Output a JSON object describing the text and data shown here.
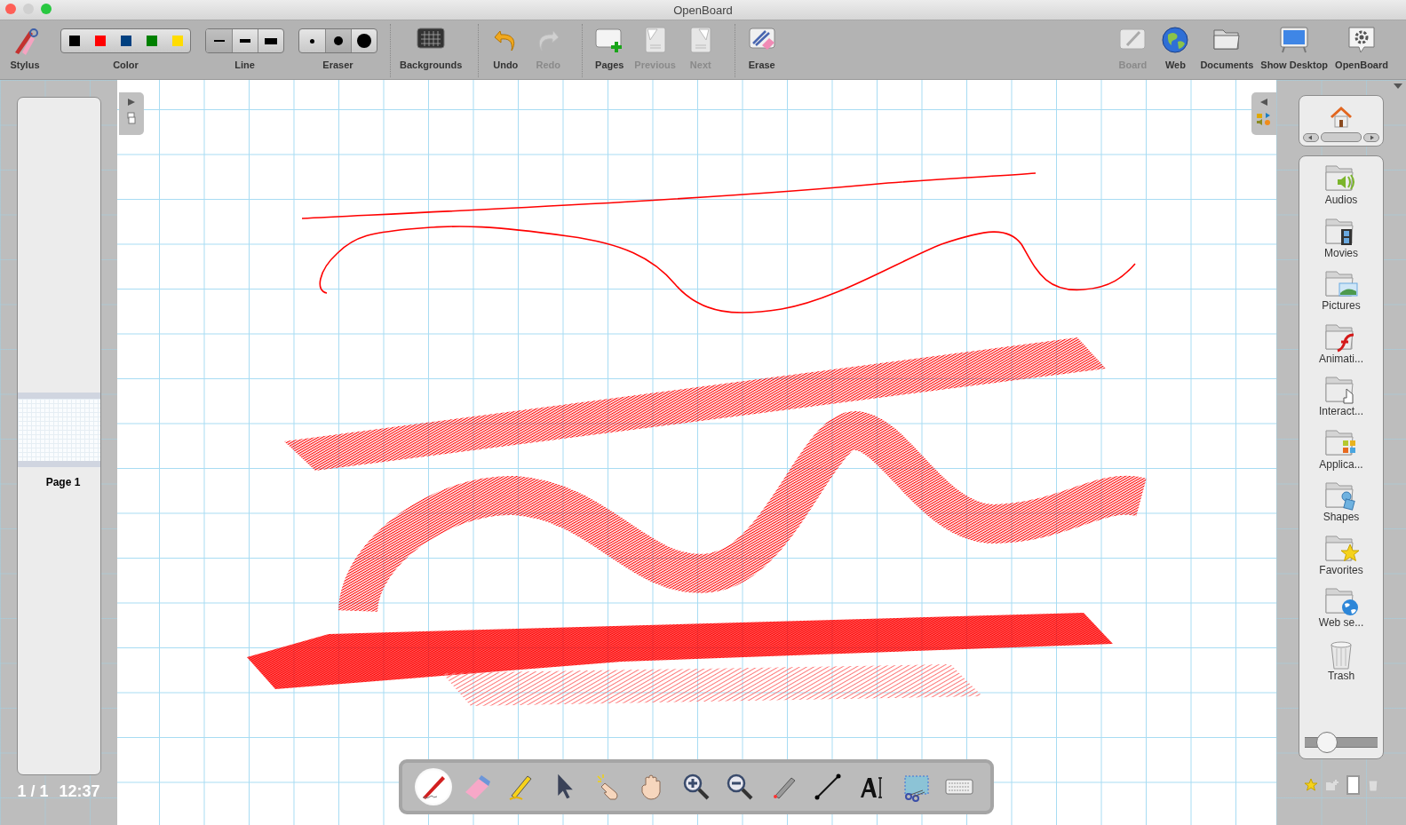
{
  "window": {
    "title": "OpenBoard"
  },
  "toolbar": {
    "stylus": {
      "label": "Stylus"
    },
    "color": {
      "label": "Color",
      "swatches": [
        {
          "color": "#000000"
        },
        {
          "color": "#ff0000"
        },
        {
          "color": "#004080"
        },
        {
          "color": "#008000"
        },
        {
          "color": "#ffdc00"
        }
      ]
    },
    "line": {
      "label": "Line",
      "options": [
        {
          "selected": true
        },
        {
          "selected": false
        },
        {
          "selected": false
        }
      ]
    },
    "eraser": {
      "label": "Eraser",
      "options": [
        {
          "selected": false
        },
        {
          "selected": true
        },
        {
          "selected": false
        }
      ]
    },
    "actions": [
      {
        "label": "Backgrounds",
        "disabled": false
      },
      {
        "label": "Undo",
        "disabled": false
      },
      {
        "label": "Redo",
        "disabled": true
      },
      {
        "label": "Pages",
        "disabled": false
      },
      {
        "label": "Previous",
        "disabled": true
      },
      {
        "label": "Next",
        "disabled": true
      },
      {
        "label": "Erase",
        "disabled": false
      }
    ],
    "modes": [
      {
        "label": "Board",
        "disabled": true
      },
      {
        "label": "Web",
        "disabled": false
      },
      {
        "label": "Documents",
        "disabled": false
      },
      {
        "label": "Show Desktop",
        "disabled": false
      },
      {
        "label": "OpenBoard",
        "disabled": false
      }
    ]
  },
  "pages_panel": {
    "pages": [
      {
        "label": "Page 1",
        "selected": true
      }
    ],
    "page_count": "1 / 1",
    "time": "12:37"
  },
  "library": {
    "items": [
      {
        "label": "Audios"
      },
      {
        "label": "Movies"
      },
      {
        "label": "Pictures"
      },
      {
        "label": "Animati..."
      },
      {
        "label": "Interact..."
      },
      {
        "label": "Applica..."
      },
      {
        "label": "Shapes"
      },
      {
        "label": "Favorites"
      },
      {
        "label": "Web se..."
      },
      {
        "label": "Trash"
      }
    ],
    "zoom_slider": {
      "level": 0.3
    }
  },
  "tools": [
    {
      "selected": true
    },
    {
      "selected": false
    },
    {
      "selected": false
    },
    {
      "selected": false
    },
    {
      "selected": false
    },
    {
      "selected": false
    },
    {
      "selected": false
    },
    {
      "selected": false
    },
    {
      "selected": false
    },
    {
      "selected": false
    },
    {
      "selected": false
    },
    {
      "selected": false
    },
    {
      "selected": false
    }
  ]
}
